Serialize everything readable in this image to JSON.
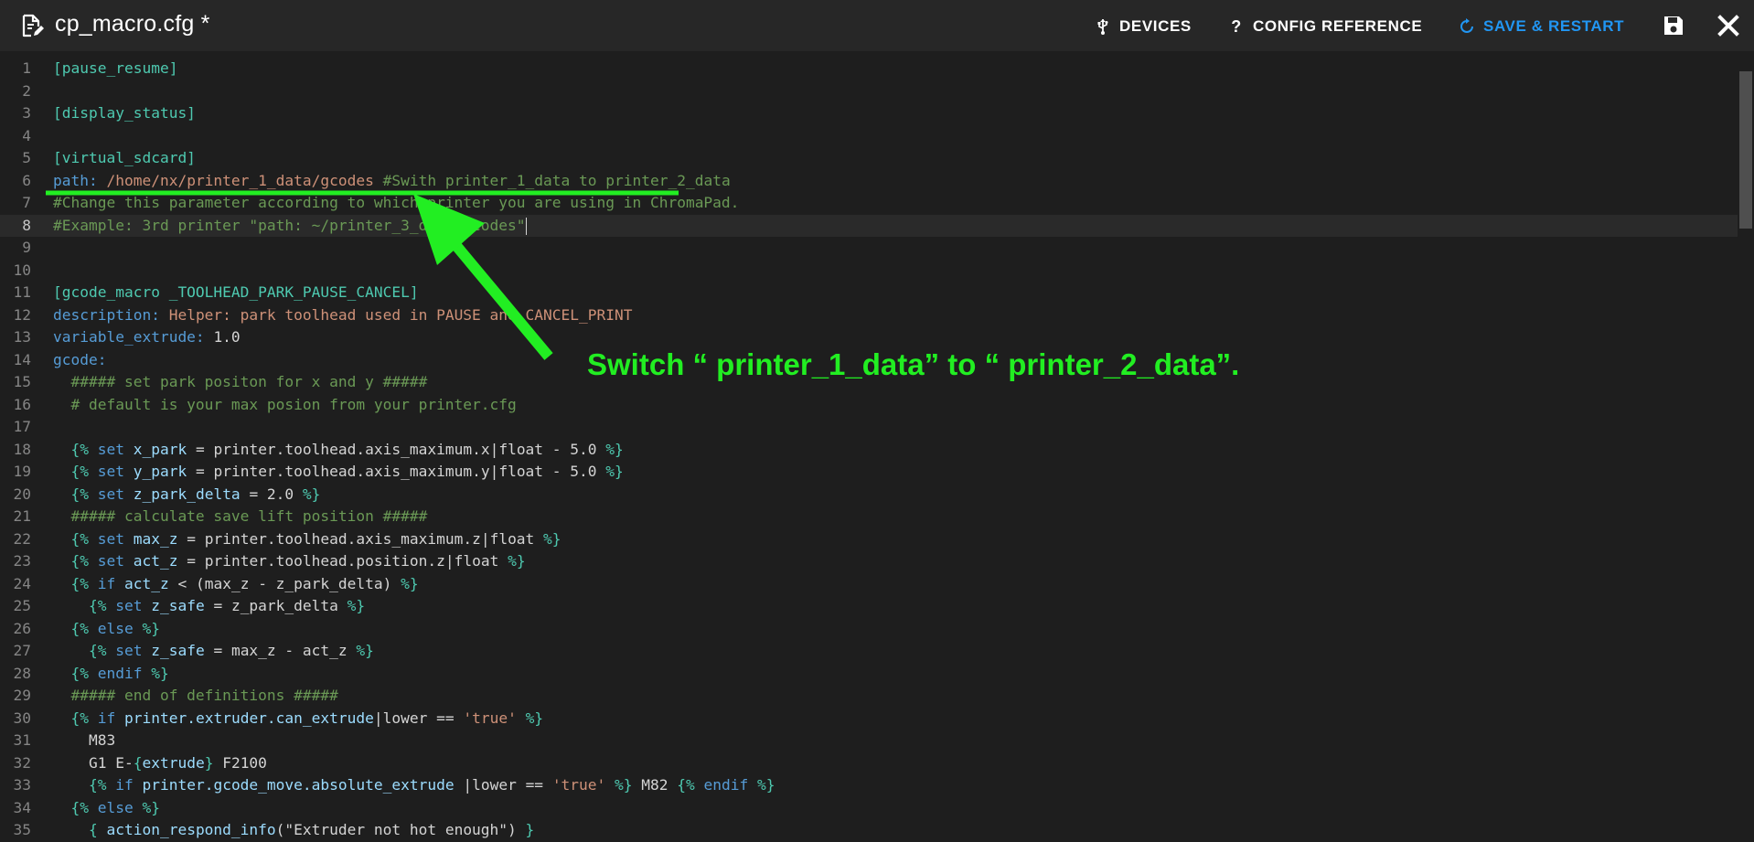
{
  "header": {
    "title": "cp_macro.cfg *",
    "devices_label": "DEVICES",
    "config_reference_label": "CONFIG REFERENCE",
    "save_restart_label": "SAVE & RESTART"
  },
  "editor": {
    "active_line": 8,
    "lines": [
      [
        [
          "sec",
          "[pause_resume]"
        ]
      ],
      [],
      [
        [
          "sec",
          "[display_status]"
        ]
      ],
      [],
      [
        [
          "sec",
          "[virtual_sdcard]"
        ]
      ],
      [
        [
          "key",
          "path: "
        ],
        [
          "val",
          "/home/nx/printer_1_data/gcodes "
        ],
        [
          "cmt",
          "#Swith printer_1_data to printer_2_data"
        ]
      ],
      [
        [
          "cmt",
          "#Change this parameter according to which printer you are using in ChromaPad."
        ]
      ],
      [
        [
          "cmt",
          "#Example: 3rd printer \"path: ~/printer_3_data/gcodes\""
        ]
      ],
      [],
      [],
      [
        [
          "sec",
          "[gcode_macro _TOOLHEAD_PARK_PAUSE_CANCEL]"
        ]
      ],
      [
        [
          "key",
          "description: "
        ],
        [
          "val",
          "Helper: park toolhead used in PAUSE and CANCEL_PRINT"
        ]
      ],
      [
        [
          "key",
          "variable_extrude: "
        ],
        [
          "pl",
          "1.0"
        ]
      ],
      [
        [
          "key",
          "gcode:"
        ]
      ],
      [
        [
          "cmt",
          "  ##### set park positon for x and y #####"
        ]
      ],
      [
        [
          "cmt",
          "  # default is your max posion from your printer.cfg"
        ]
      ],
      [],
      [
        [
          "pl",
          "  "
        ],
        [
          "jin",
          "{% "
        ],
        [
          "kw",
          "set "
        ],
        [
          "var",
          "x_park "
        ],
        [
          "pl",
          "= printer.toolhead.axis_maximum.x|float - 5.0 "
        ],
        [
          "jin",
          "%}"
        ]
      ],
      [
        [
          "pl",
          "  "
        ],
        [
          "jin",
          "{% "
        ],
        [
          "kw",
          "set "
        ],
        [
          "var",
          "y_park "
        ],
        [
          "pl",
          "= printer.toolhead.axis_maximum.y|float - 5.0 "
        ],
        [
          "jin",
          "%}"
        ]
      ],
      [
        [
          "pl",
          "  "
        ],
        [
          "jin",
          "{% "
        ],
        [
          "kw",
          "set "
        ],
        [
          "var",
          "z_park_delta "
        ],
        [
          "pl",
          "= 2.0 "
        ],
        [
          "jin",
          "%}"
        ]
      ],
      [
        [
          "cmt",
          "  ##### calculate save lift position #####"
        ]
      ],
      [
        [
          "pl",
          "  "
        ],
        [
          "jin",
          "{% "
        ],
        [
          "kw",
          "set "
        ],
        [
          "var",
          "max_z "
        ],
        [
          "pl",
          "= printer.toolhead.axis_maximum.z|float "
        ],
        [
          "jin",
          "%}"
        ]
      ],
      [
        [
          "pl",
          "  "
        ],
        [
          "jin",
          "{% "
        ],
        [
          "kw",
          "set "
        ],
        [
          "var",
          "act_z "
        ],
        [
          "pl",
          "= printer.toolhead.position.z|float "
        ],
        [
          "jin",
          "%}"
        ]
      ],
      [
        [
          "pl",
          "  "
        ],
        [
          "jin",
          "{% "
        ],
        [
          "kw",
          "if "
        ],
        [
          "var",
          "act_z "
        ],
        [
          "pl",
          "< (max_z - z_park_delta) "
        ],
        [
          "jin",
          "%}"
        ]
      ],
      [
        [
          "pl",
          "    "
        ],
        [
          "jin",
          "{% "
        ],
        [
          "kw",
          "set "
        ],
        [
          "var",
          "z_safe "
        ],
        [
          "pl",
          "= z_park_delta "
        ],
        [
          "jin",
          "%}"
        ]
      ],
      [
        [
          "pl",
          "  "
        ],
        [
          "jin",
          "{% "
        ],
        [
          "kw",
          "else "
        ],
        [
          "jin",
          "%}"
        ]
      ],
      [
        [
          "pl",
          "    "
        ],
        [
          "jin",
          "{% "
        ],
        [
          "kw",
          "set "
        ],
        [
          "var",
          "z_safe "
        ],
        [
          "pl",
          "= max_z - act_z "
        ],
        [
          "jin",
          "%}"
        ]
      ],
      [
        [
          "pl",
          "  "
        ],
        [
          "jin",
          "{% "
        ],
        [
          "kw",
          "endif "
        ],
        [
          "jin",
          "%}"
        ]
      ],
      [
        [
          "cmt",
          "  ##### end of definitions #####"
        ]
      ],
      [
        [
          "pl",
          "  "
        ],
        [
          "jin",
          "{% "
        ],
        [
          "kw",
          "if "
        ],
        [
          "var",
          "printer.extruder.can_extrude"
        ],
        [
          "pl",
          "|lower == "
        ],
        [
          "str",
          "'true' "
        ],
        [
          "jin",
          "%}"
        ]
      ],
      [
        [
          "pl",
          "    M83"
        ]
      ],
      [
        [
          "pl",
          "    G1 E-"
        ],
        [
          "jin",
          "{"
        ],
        [
          "var",
          "extrude"
        ],
        [
          "jin",
          "}"
        ],
        [
          "pl",
          " F2100"
        ]
      ],
      [
        [
          "pl",
          "    "
        ],
        [
          "jin",
          "{% "
        ],
        [
          "kw",
          "if "
        ],
        [
          "var",
          "printer.gcode_move.absolute_extrude "
        ],
        [
          "pl",
          "|lower == "
        ],
        [
          "str",
          "'true' "
        ],
        [
          "jin",
          "%}"
        ],
        [
          "pl",
          " M82 "
        ],
        [
          "jin",
          "{% "
        ],
        [
          "kw",
          "endif "
        ],
        [
          "jin",
          "%}"
        ]
      ],
      [
        [
          "pl",
          "  "
        ],
        [
          "jin",
          "{% "
        ],
        [
          "kw",
          "else "
        ],
        [
          "jin",
          "%}"
        ]
      ],
      [
        [
          "pl",
          "    "
        ],
        [
          "jin",
          "{ "
        ],
        [
          "var",
          "action_respond_info"
        ],
        [
          "pl",
          "(\"Extruder not hot enough\")"
        ],
        [
          "jin",
          " }"
        ]
      ]
    ]
  },
  "annotation": {
    "text": "Switch “ printer_1_data” to “ printer_2_data”."
  },
  "colors": {
    "background": "#1e1e1e",
    "topbar": "#272727",
    "accent": "#2196f3",
    "annotation": "#22ee22"
  }
}
